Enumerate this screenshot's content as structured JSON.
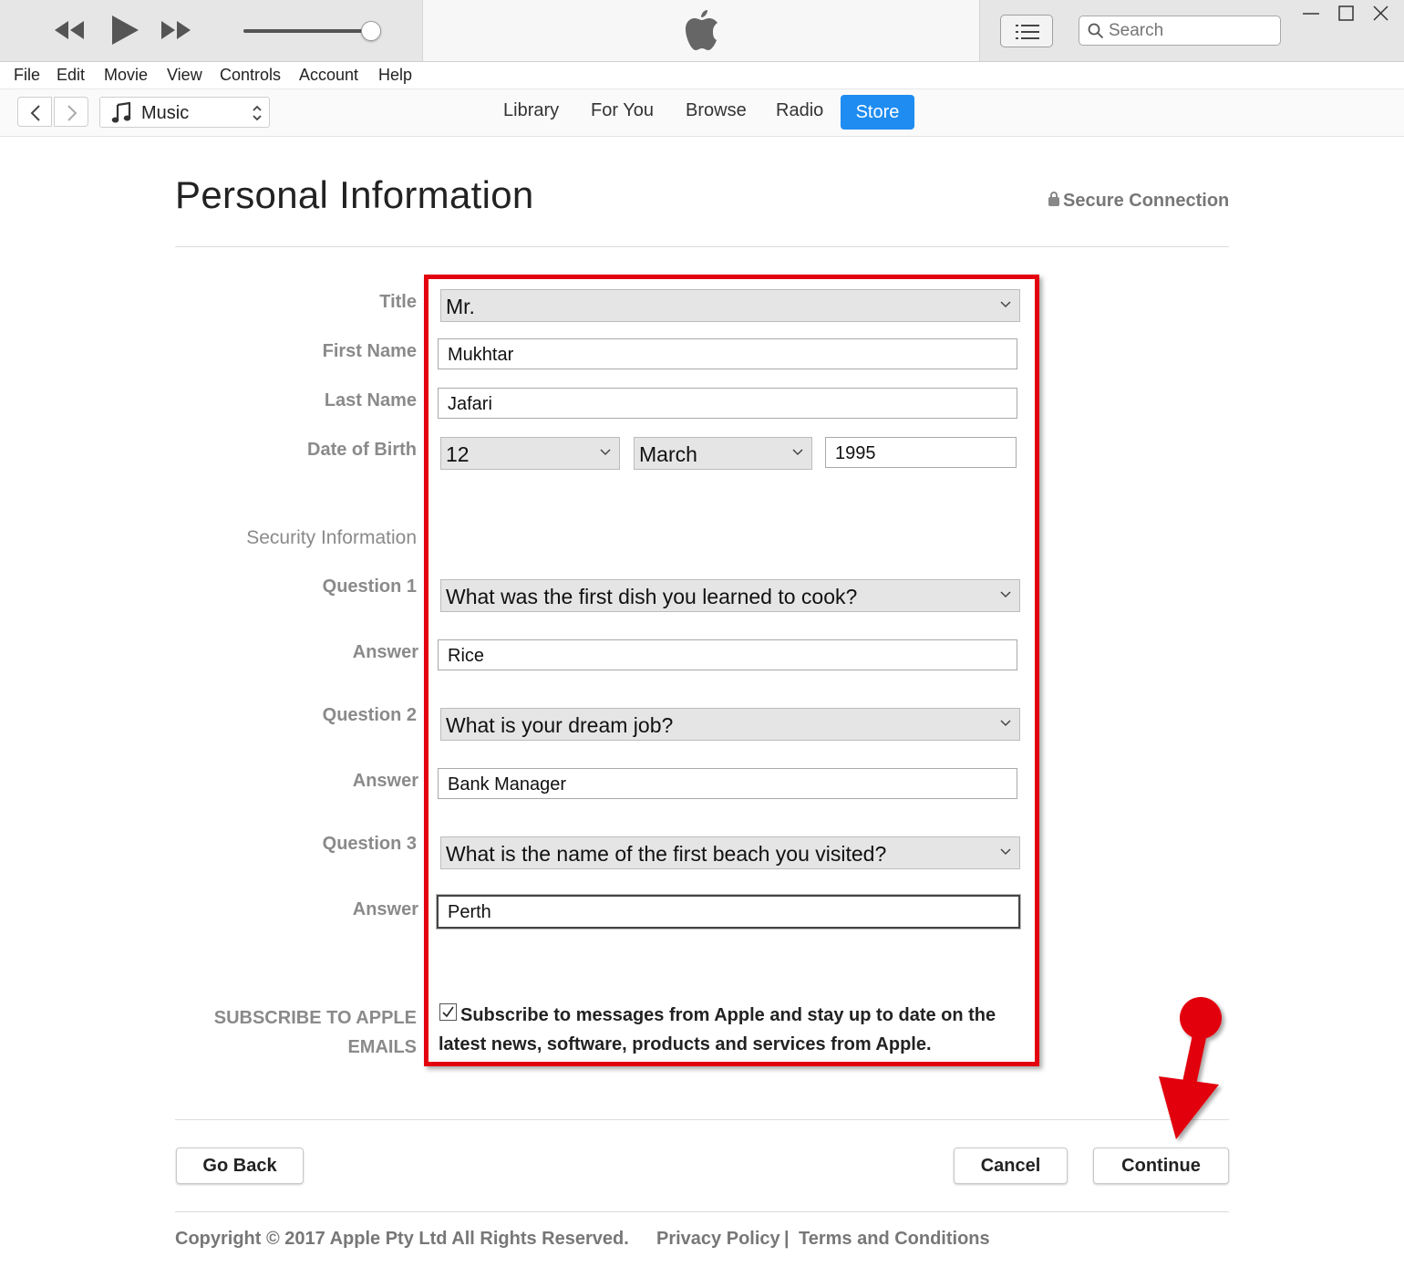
{
  "player": {
    "search_placeholder": "Search"
  },
  "menu": [
    "File",
    "Edit",
    "Movie",
    "View",
    "Controls",
    "Account",
    "Help"
  ],
  "nav": {
    "media_kind": "Music",
    "tabs": [
      "Library",
      "For You",
      "Browse",
      "Radio"
    ],
    "active_tab": "Store"
  },
  "page": {
    "title": "Personal Information",
    "secure_label": "Secure Connection"
  },
  "form": {
    "title_label": "Title",
    "title_value": "Mr.",
    "first_name_label": "First Name",
    "first_name_value": "Mukhtar",
    "last_name_label": "Last Name",
    "last_name_value": "Jafari",
    "dob_label": "Date of Birth",
    "dob_day": "12",
    "dob_month": "March",
    "dob_year": "1995",
    "security_section": "Security Information",
    "q1_label": "Question 1",
    "q1_value": "What was the first dish you learned to cook?",
    "a1_label": "Answer",
    "a1_value": "Rice",
    "q2_label": "Question 2",
    "q2_value": "What is your dream job?",
    "a2_label": "Answer",
    "a2_value": "Bank Manager",
    "q3_label": "Question 3",
    "q3_value": "What is the name of the first beach you visited?",
    "a3_label": "Answer",
    "a3_value": "Perth",
    "subscribe_label_line1": "SUBSCRIBE TO APPLE",
    "subscribe_label_line2": "EMAILS",
    "subscribe_checked": true,
    "subscribe_text": "Subscribe to messages from Apple and stay up to date on the latest news, software, products and services from Apple."
  },
  "buttons": {
    "go_back": "Go Back",
    "cancel": "Cancel",
    "continue": "Continue"
  },
  "footer": {
    "copyright": "Copyright © 2017 Apple Pty Ltd All Rights Reserved.",
    "privacy": "Privacy Policy",
    "separator": "|",
    "terms": "Terms and Conditions"
  },
  "annotation_color": "#e3000f",
  "accent_color": "#1e8cf0"
}
